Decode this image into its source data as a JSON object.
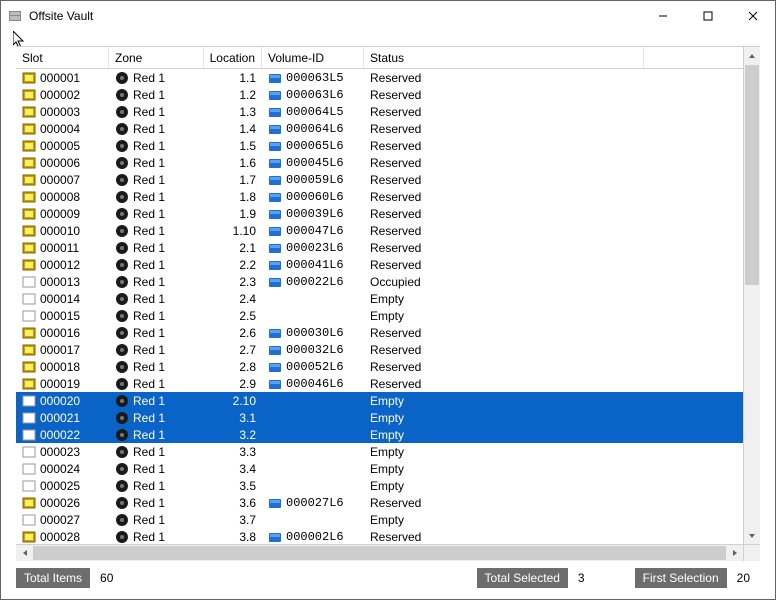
{
  "window": {
    "title": "Offsite Vault"
  },
  "columns": {
    "slot": "Slot",
    "zone": "Zone",
    "location": "Location",
    "volume": "Volume-ID",
    "status": "Status"
  },
  "rows": [
    {
      "slot": "000001",
      "slot_icon": "slot-full",
      "zone": "Red 1",
      "location": "1.1",
      "volume": "000063L5",
      "status": "Reserved",
      "selected": false
    },
    {
      "slot": "000002",
      "slot_icon": "slot-full",
      "zone": "Red 1",
      "location": "1.2",
      "volume": "000063L6",
      "status": "Reserved",
      "selected": false
    },
    {
      "slot": "000003",
      "slot_icon": "slot-full",
      "zone": "Red 1",
      "location": "1.3",
      "volume": "000064L5",
      "status": "Reserved",
      "selected": false
    },
    {
      "slot": "000004",
      "slot_icon": "slot-full",
      "zone": "Red 1",
      "location": "1.4",
      "volume": "000064L6",
      "status": "Reserved",
      "selected": false
    },
    {
      "slot": "000005",
      "slot_icon": "slot-full",
      "zone": "Red 1",
      "location": "1.5",
      "volume": "000065L6",
      "status": "Reserved",
      "selected": false
    },
    {
      "slot": "000006",
      "slot_icon": "slot-full",
      "zone": "Red 1",
      "location": "1.6",
      "volume": "000045L6",
      "status": "Reserved",
      "selected": false
    },
    {
      "slot": "000007",
      "slot_icon": "slot-full",
      "zone": "Red 1",
      "location": "1.7",
      "volume": "000059L6",
      "status": "Reserved",
      "selected": false
    },
    {
      "slot": "000008",
      "slot_icon": "slot-full",
      "zone": "Red 1",
      "location": "1.8",
      "volume": "000060L6",
      "status": "Reserved",
      "selected": false
    },
    {
      "slot": "000009",
      "slot_icon": "slot-full",
      "zone": "Red 1",
      "location": "1.9",
      "volume": "000039L6",
      "status": "Reserved",
      "selected": false
    },
    {
      "slot": "000010",
      "slot_icon": "slot-full",
      "zone": "Red 1",
      "location": "1.10",
      "volume": "000047L6",
      "status": "Reserved",
      "selected": false
    },
    {
      "slot": "000011",
      "slot_icon": "slot-full",
      "zone": "Red 1",
      "location": "2.1",
      "volume": "000023L6",
      "status": "Reserved",
      "selected": false
    },
    {
      "slot": "000012",
      "slot_icon": "slot-full",
      "zone": "Red 1",
      "location": "2.2",
      "volume": "000041L6",
      "status": "Reserved",
      "selected": false
    },
    {
      "slot": "000013",
      "slot_icon": "slot-empty",
      "zone": "Red 1",
      "location": "2.3",
      "volume": "000022L6",
      "status": "Occupied",
      "selected": false
    },
    {
      "slot": "000014",
      "slot_icon": "slot-empty",
      "zone": "Red 1",
      "location": "2.4",
      "volume": "",
      "status": "Empty",
      "selected": false
    },
    {
      "slot": "000015",
      "slot_icon": "slot-empty",
      "zone": "Red 1",
      "location": "2.5",
      "volume": "",
      "status": "Empty",
      "selected": false
    },
    {
      "slot": "000016",
      "slot_icon": "slot-full",
      "zone": "Red 1",
      "location": "2.6",
      "volume": "000030L6",
      "status": "Reserved",
      "selected": false
    },
    {
      "slot": "000017",
      "slot_icon": "slot-full",
      "zone": "Red 1",
      "location": "2.7",
      "volume": "000032L6",
      "status": "Reserved",
      "selected": false
    },
    {
      "slot": "000018",
      "slot_icon": "slot-full",
      "zone": "Red 1",
      "location": "2.8",
      "volume": "000052L6",
      "status": "Reserved",
      "selected": false
    },
    {
      "slot": "000019",
      "slot_icon": "slot-full",
      "zone": "Red 1",
      "location": "2.9",
      "volume": "000046L6",
      "status": "Reserved",
      "selected": false
    },
    {
      "slot": "000020",
      "slot_icon": "slot-empty",
      "zone": "Red 1",
      "location": "2.10",
      "volume": "",
      "status": "Empty",
      "selected": true
    },
    {
      "slot": "000021",
      "slot_icon": "slot-empty",
      "zone": "Red 1",
      "location": "3.1",
      "volume": "",
      "status": "Empty",
      "selected": true
    },
    {
      "slot": "000022",
      "slot_icon": "slot-empty",
      "zone": "Red 1",
      "location": "3.2",
      "volume": "",
      "status": "Empty",
      "selected": true
    },
    {
      "slot": "000023",
      "slot_icon": "slot-empty",
      "zone": "Red 1",
      "location": "3.3",
      "volume": "",
      "status": "Empty",
      "selected": false
    },
    {
      "slot": "000024",
      "slot_icon": "slot-empty",
      "zone": "Red 1",
      "location": "3.4",
      "volume": "",
      "status": "Empty",
      "selected": false
    },
    {
      "slot": "000025",
      "slot_icon": "slot-empty",
      "zone": "Red 1",
      "location": "3.5",
      "volume": "",
      "status": "Empty",
      "selected": false
    },
    {
      "slot": "000026",
      "slot_icon": "slot-full",
      "zone": "Red 1",
      "location": "3.6",
      "volume": "000027L6",
      "status": "Reserved",
      "selected": false
    },
    {
      "slot": "000027",
      "slot_icon": "slot-empty",
      "zone": "Red 1",
      "location": "3.7",
      "volume": "",
      "status": "Empty",
      "selected": false
    },
    {
      "slot": "000028",
      "slot_icon": "slot-full",
      "zone": "Red 1",
      "location": "3.8",
      "volume": "000002L6",
      "status": "Reserved",
      "selected": false
    }
  ],
  "status": {
    "total_items_label": "Total Items",
    "total_items_value": "60",
    "total_selected_label": "Total Selected",
    "total_selected_value": "3",
    "first_selection_label": "First Selection",
    "first_selection_value": "20"
  }
}
